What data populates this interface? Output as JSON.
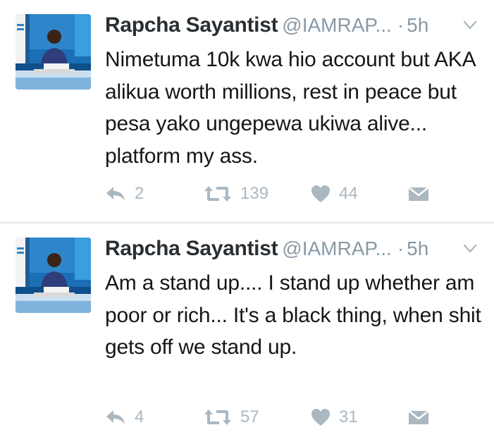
{
  "tweets": [
    {
      "name": "Rapcha Sayantist",
      "handle": "@IAMRAP...",
      "dot": "·",
      "time": "5h",
      "text": "Nimetuma 10k kwa hio account but AKA alikua worth millions, rest in peace but pesa yako ungepewa ukiwa alive... platform my ass.",
      "replies": "2",
      "retweets": "139",
      "likes": "44"
    },
    {
      "name": "Rapcha Sayantist",
      "handle": "@IAMRAP...",
      "dot": "·",
      "time": "5h",
      "text": "Am a stand up.... I stand up whether am poor or rich... It's a black thing, when shit gets off we stand up.",
      "replies": "4",
      "retweets": "57",
      "likes": "31"
    }
  ],
  "icons": {
    "reply": "reply-icon",
    "retweet": "retweet-icon",
    "like": "heart-icon",
    "dm": "direct-message-icon",
    "caret": "chevron-down-icon"
  },
  "colors": {
    "name": "#292f33",
    "meta": "#8899a6",
    "action": "#aab8c2",
    "divider": "#e1e8ed"
  }
}
